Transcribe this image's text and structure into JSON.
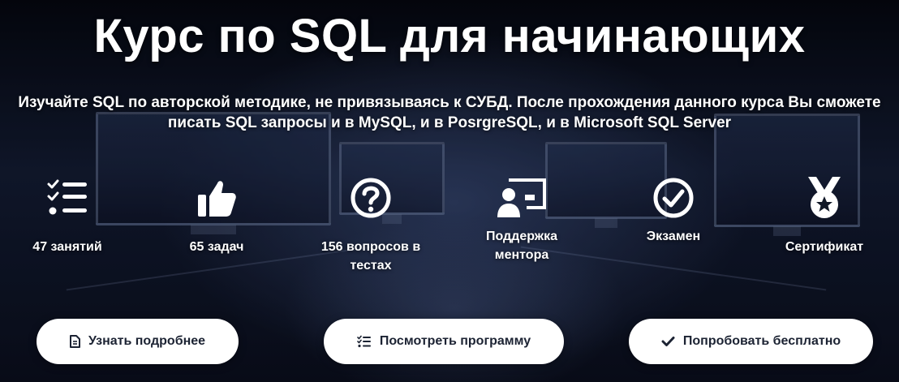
{
  "hero": {
    "title": "Курс по SQL для начинающих",
    "subtitle_line1": "Изучайте SQL по авторской методике, не привязываясь к СУБД. После прохождения данного курса Вы сможете",
    "subtitle_line2": "писать SQL запросы и в MySQL, и в PosrgreSQL, и в Microsoft SQL Server"
  },
  "features": [
    {
      "icon": "list-check-icon",
      "line1": "47 занятий",
      "line2": ""
    },
    {
      "icon": "thumbs-up-icon",
      "line1": "65 задач",
      "line2": ""
    },
    {
      "icon": "question-circle-icon",
      "line1": "156 вопросов в",
      "line2": "тестах"
    },
    {
      "icon": "mentor-presentation-icon",
      "line1": "Поддержка",
      "line2": "ментора"
    },
    {
      "icon": "check-circle-icon",
      "line1": "Экзамен",
      "line2": ""
    },
    {
      "icon": "medal-icon",
      "line1": "Сертификат",
      "line2": ""
    }
  ],
  "buttons": [
    {
      "icon": "document-icon",
      "label": "Узнать подробнее"
    },
    {
      "icon": "list-check-icon",
      "label": "Посмотреть программу"
    },
    {
      "icon": "check-icon",
      "label": "Попробовать бесплатно"
    }
  ],
  "colors": {
    "text": "#ffffff",
    "button_bg": "#ffffff",
    "button_text": "#1c2333"
  }
}
